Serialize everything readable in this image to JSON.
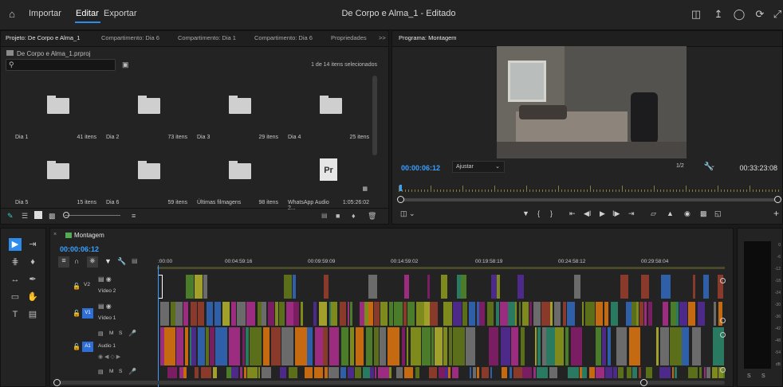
{
  "menu": {
    "importar": "Importar",
    "editar": "Editar",
    "exportar": "Exportar"
  },
  "window_title": "De Corpo e Alma_1 - Editado",
  "project": {
    "tabs": [
      "Projeto: De Corpo e Alma_1",
      "Compartimento: Dia 6",
      "Compartimento: Dia 1",
      "Compartimento: Dia 6",
      "Propriedades"
    ],
    "tab_overflow": ">>",
    "path": "De Corpo e Alma_1.prproj",
    "selection_count": "1 de 14 itens selecionados",
    "bins": [
      {
        "name": "Dia 1",
        "count": "41 itens"
      },
      {
        "name": "Dia 2",
        "count": "73 itens"
      },
      {
        "name": "Dia 3",
        "count": "29 itens"
      },
      {
        "name": "Dia 4",
        "count": "25 itens"
      },
      {
        "name": "Dia 5",
        "count": "15 itens"
      },
      {
        "name": "Dia 6",
        "count": "59 itens"
      },
      {
        "name": "Últimas filmagens",
        "count": "98 itens"
      },
      {
        "name": "WhatsApp Audio 2...",
        "count": "1:05:26:02"
      }
    ],
    "pr_label": "Pr"
  },
  "program": {
    "tab": "Programa: Montagem",
    "timecode": "00:00:06:12",
    "fit": "Ajustar",
    "resolution": "1/2",
    "duration": "00:33:23:08"
  },
  "timeline": {
    "tab": "Montagem",
    "timecode": "00:00:06:12",
    "ruler": [
      ":00:00",
      "00:04:59:16",
      "00:09:59:09",
      "00:14:59:02",
      "00:19:58:19",
      "00:24:58:12",
      "00:29:58:04"
    ],
    "tracks": [
      {
        "id": "V2",
        "name": "Vídeo 2"
      },
      {
        "id": "V1",
        "name": "Vídeo 1"
      },
      {
        "id": "A1",
        "name": "Audio 1"
      }
    ],
    "track_letters": {
      "m": "M",
      "s": "S"
    }
  },
  "meter": {
    "scale": [
      "0",
      "-6",
      "-12",
      "-18",
      "-24",
      "-30",
      "-36",
      "-42",
      "-48",
      "-54",
      "dB"
    ],
    "solo": [
      "S",
      "S"
    ]
  },
  "colors": {
    "accent": "#2d8ceb",
    "timecode": "#3aa0ff",
    "bg": "#1a1a1a",
    "panel": "#232323"
  }
}
